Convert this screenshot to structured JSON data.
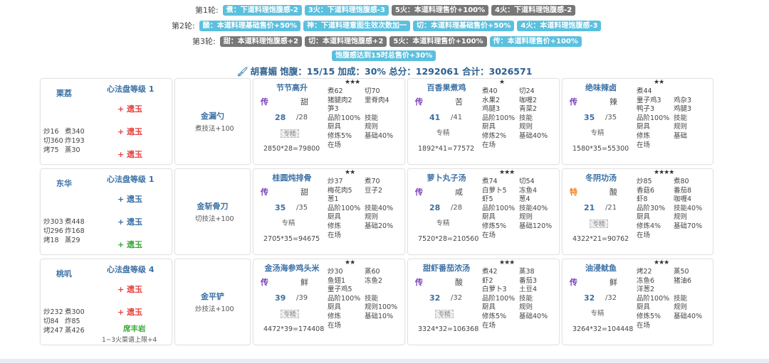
{
  "rounds": [
    {
      "label": "第1轮:",
      "tags": [
        {
          "text": "煮：下道料理饱腹感-2",
          "color": "blue"
        },
        {
          "text": "3火：下道料理饱腹感-3",
          "color": "blue"
        },
        {
          "text": "5火：本道料理售价+100%",
          "color": "gray"
        },
        {
          "text": "4火：下道料理饱腹感-2",
          "color": "gray"
        }
      ]
    },
    {
      "label": "第2轮:",
      "tags": [
        {
          "text": "酸：本道料理基础售价+50%",
          "color": "blue"
        },
        {
          "text": "神：下道料理意图生效次数加一",
          "color": "blue"
        },
        {
          "text": "切：本道料理基础售价+50%",
          "color": "blue"
        },
        {
          "text": "4火：本道料理饱腹感-3",
          "color": "blue"
        }
      ]
    },
    {
      "label": "第3轮:",
      "tags": [
        {
          "text": "甜：本道料理饱腹感+2",
          "color": "gray"
        },
        {
          "text": "切：本道料理饱腹感+2",
          "color": "gray"
        },
        {
          "text": "5火：本道料理售价+100%",
          "color": "gray"
        },
        {
          "text": "传：本道料理售价+100%",
          "color": "blue"
        }
      ],
      "extra": {
        "text": "饱腹感达到15时总售价+30%",
        "color": "blue"
      }
    }
  ],
  "summary": {
    "text": "胡喜媚 饱腹：15/15 加成：30% 总分：1292061 合计：3026571",
    "icon": "brush-icon"
  },
  "chefs": [
    {
      "name": "栗荔",
      "level": "心法盘等级 1",
      "gems": [
        {
          "text": "+ 遗玉",
          "color": "red"
        },
        {
          "text": "+ 遗玉",
          "color": "red"
        },
        {
          "text": "+ 遗玉",
          "color": "red"
        }
      ],
      "stats": [
        [
          "炒16",
          "煮340"
        ],
        [
          "切360",
          "炸193"
        ],
        [
          "烤75",
          "蒸30"
        ]
      ],
      "aura": null,
      "aura_desc": null
    },
    {
      "name": "东华",
      "level": "心法盘等级 1",
      "gems": [
        {
          "text": "+ 遗玉",
          "color": "blue"
        },
        {
          "text": "+ 遗玉",
          "color": "blue"
        },
        {
          "text": "+ 遗玉",
          "color": "green"
        }
      ],
      "stats": [
        [
          "炒303",
          "煮448"
        ],
        [
          "切296",
          "炸168"
        ],
        [
          "烤18",
          "蒸29"
        ]
      ],
      "aura": null,
      "aura_desc": null
    },
    {
      "name": "桃叽",
      "level": "心法盘等级 4",
      "gems": [
        {
          "text": "+ 遗玉",
          "color": "red"
        },
        {
          "text": "+ 遗玉",
          "color": "red"
        }
      ],
      "stats": [
        [
          "炒232",
          "煮300"
        ],
        [
          "切84",
          "炸85"
        ],
        [
          "烤247",
          "蒸426"
        ]
      ],
      "aura": "席丰岩",
      "aura_desc": "1~3火菜谱上限+4"
    }
  ],
  "equips": [
    {
      "name": "金漏勺",
      "skill": "煮技法+100"
    },
    {
      "name": "金斩骨刀",
      "skill": "切技法+100"
    },
    {
      "name": "金平铲",
      "skill": "炒技法+100"
    }
  ],
  "recipes": [
    [
      {
        "name": "节节高升",
        "stars": "★★★",
        "cond": "传",
        "taste": "甜",
        "qty": "28",
        "max": "/28",
        "flag": "专精",
        "flag_style": "box",
        "total": "2850*28=79800",
        "info": [
          [
            "煮62",
            "切70"
          ],
          [
            "猪腿肉2",
            "里脊肉4"
          ],
          [
            "笋3",
            ""
          ],
          [
            "品阶100%",
            "技能"
          ],
          [
            "厨具",
            "规则"
          ],
          [
            "修炼5%",
            "基础40%"
          ],
          [
            "在场",
            ""
          ]
        ]
      },
      {
        "name": "百香果煮鸡",
        "stars": "★",
        "cond": "传",
        "taste": "苦",
        "qty": "41",
        "max": "/41",
        "flag": "专精",
        "flag_style": "plain",
        "total": "1892*41=77572",
        "info": [
          [
            "煮40",
            "切24"
          ],
          [
            "水果2",
            "咖喱2"
          ],
          [
            "鸡腿3",
            "青菜2"
          ],
          [
            "品阶100%",
            "技能"
          ],
          [
            "厨具",
            "规则"
          ],
          [
            "修炼2%",
            "基础40%"
          ],
          [
            "在场",
            ""
          ]
        ]
      },
      {
        "name": "绝味辣卤",
        "stars": "★★",
        "cond": "传",
        "taste": "辣",
        "qty": "35",
        "max": "/35",
        "flag": "专精",
        "flag_style": "plain",
        "total": "1580*35=55300",
        "info": [
          [
            "煮44",
            ""
          ],
          [
            "童子鸡3",
            "鸡杂3"
          ],
          [
            "鸭子3",
            "鸡腿3"
          ],
          [
            "品阶100%",
            "技能"
          ],
          [
            "厨具",
            "规则"
          ],
          [
            "修炼",
            "基础"
          ],
          [
            "在场",
            ""
          ]
        ]
      }
    ],
    [
      {
        "name": "桂圆炖排骨",
        "stars": "★★",
        "cond": "传",
        "taste": "甜",
        "qty": "35",
        "max": "/35",
        "flag": "专精",
        "flag_style": "plain",
        "total": "2705*35=94675",
        "info": [
          [
            "炒37",
            "煮70"
          ],
          [
            "梅花肉5",
            "豆子2"
          ],
          [
            "葱1",
            ""
          ],
          [
            "品阶100%",
            "技能40%"
          ],
          [
            "厨具",
            "规则"
          ],
          [
            "修炼",
            "基础20%"
          ],
          [
            "在场",
            ""
          ]
        ]
      },
      {
        "name": "萝卜丸子汤",
        "stars": "★★★",
        "cond": "传",
        "taste": "咸",
        "qty": "28",
        "max": "/28",
        "flag": "专精",
        "flag_style": "plain",
        "total": "7520*28=210560",
        "info": [
          [
            "煮74",
            "切54"
          ],
          [
            "白萝卜5",
            "冻鱼4"
          ],
          [
            "虾5",
            "葱4"
          ],
          [
            "品阶100%",
            "技能40%"
          ],
          [
            "厨具",
            "规则"
          ],
          [
            "修炼5%",
            "基础120%"
          ],
          [
            "在场",
            ""
          ]
        ]
      },
      {
        "name": "冬阴功汤",
        "stars": "★★★★",
        "cond": "特",
        "taste": "酸",
        "qty": "21",
        "max": "/21",
        "flag": "专精",
        "flag_style": "box",
        "total": "4322*21=90762",
        "info": [
          [
            "炒85",
            "煮80"
          ],
          [
            "香菇6",
            "番茄8"
          ],
          [
            "虾8",
            "咖喱4"
          ],
          [
            "品阶30%",
            "技能40%"
          ],
          [
            "厨具",
            "规则"
          ],
          [
            "修炼4%",
            "基础70%"
          ],
          [
            "在场",
            ""
          ]
        ]
      }
    ],
    [
      {
        "name": "金汤海参鸡头米",
        "stars": "★★",
        "cond": "传",
        "taste": "鲜",
        "qty": "39",
        "max": "/39",
        "flag": "专精",
        "flag_style": "box",
        "total": "4472*39=174408",
        "info": [
          [
            "炒30",
            "蒸60"
          ],
          [
            "鱼翅1",
            "冻鱼2"
          ],
          [
            "童子鸡5",
            ""
          ],
          [
            "品阶100%",
            "技能"
          ],
          [
            "厨具",
            "规则100%"
          ],
          [
            "修炼",
            "基础10%"
          ],
          [
            "在场",
            ""
          ]
        ]
      },
      {
        "name": "甜虾番茄浓汤",
        "stars": "★★★",
        "cond": "传",
        "taste": "酸",
        "qty": "32",
        "max": "/32",
        "flag": "专精",
        "flag_style": "box",
        "total": "3324*32=106368",
        "info": [
          [
            "煮42",
            "蒸38"
          ],
          [
            "虾2",
            "番茄3"
          ],
          [
            "白萝卜3",
            "土豆4"
          ],
          [
            "品阶100%",
            "技能"
          ],
          [
            "厨具",
            "规则"
          ],
          [
            "修炼5%",
            "基础40%"
          ],
          [
            "在场",
            ""
          ]
        ]
      },
      {
        "name": "油浸鱿鱼",
        "stars": "★★★",
        "cond": "传",
        "taste": "鲜",
        "qty": "32",
        "max": "/32",
        "flag": "专精",
        "flag_style": "plain",
        "total": "3264*32=104448",
        "info": [
          [
            "烤22",
            "蒸50"
          ],
          [
            "冻鱼6",
            "猪油6"
          ],
          [
            "洋葱2",
            ""
          ],
          [
            "品阶100%",
            "技能"
          ],
          [
            "厨具",
            "规则"
          ],
          [
            "修炼5%",
            "基础40%"
          ],
          [
            "在场",
            ""
          ]
        ]
      }
    ]
  ]
}
